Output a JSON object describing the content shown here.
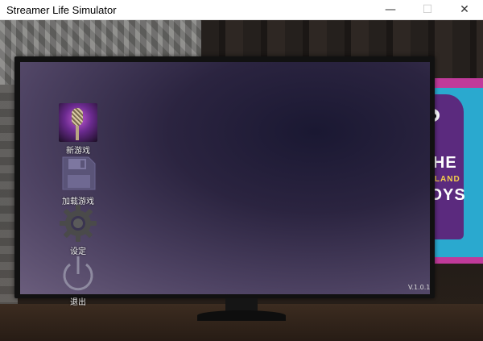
{
  "window": {
    "title": "Streamer Life Simulator",
    "controls": {
      "minimize": "—",
      "maximize": "☐",
      "close": "✕"
    }
  },
  "menu": {
    "items": [
      {
        "label": "新游戏",
        "icon": "microphone-icon"
      },
      {
        "label": "加载游戏",
        "icon": "floppy-disk-icon"
      },
      {
        "label": "设定",
        "icon": "gear-icon"
      },
      {
        "label": "退出",
        "icon": "power-icon"
      }
    ]
  },
  "version": "V.1.0.1",
  "poster": {
    "line1": "WHE",
    "line2": "WE LAND",
    "line3": "BOYS"
  },
  "colors": {
    "screen_dark": "#1a1832",
    "screen_light": "#6a5d7c",
    "poster_pink": "#c03a9a",
    "poster_blue": "#2aa9cf"
  }
}
